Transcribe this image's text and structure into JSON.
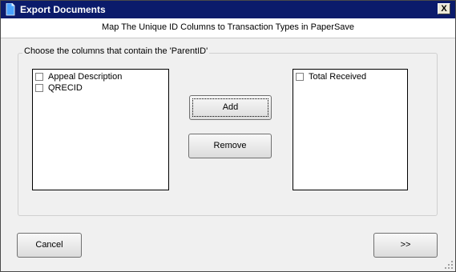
{
  "window": {
    "title": "Export Documents",
    "close_label": "X"
  },
  "header": {
    "text": "Map The Unique ID Columns to Transaction Types in PaperSave"
  },
  "group": {
    "label": "Choose the columns that contain the 'ParentID'"
  },
  "left_list": {
    "items": [
      {
        "label": "Appeal Description",
        "checked": false
      },
      {
        "label": "QRECID",
        "checked": false
      }
    ]
  },
  "right_list": {
    "items": [
      {
        "label": "Total Received",
        "checked": false
      }
    ]
  },
  "buttons": {
    "add": "Add",
    "remove": "Remove",
    "cancel": "Cancel",
    "next": ">>"
  }
}
